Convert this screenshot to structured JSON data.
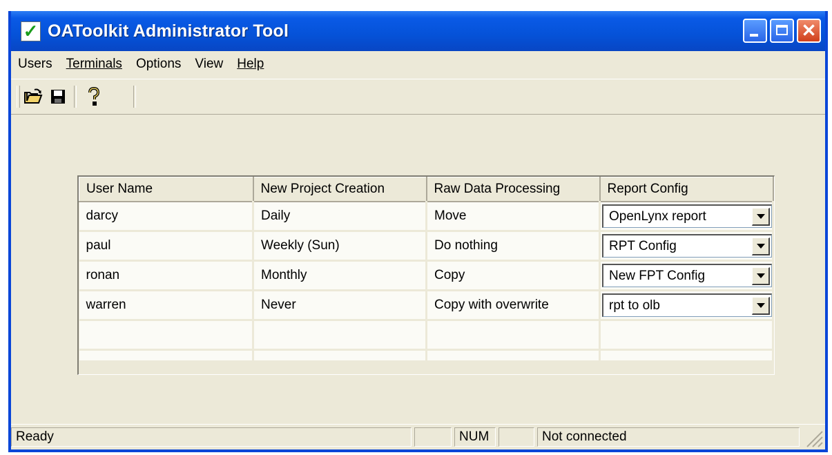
{
  "window": {
    "title": "OAToolkit Administrator Tool",
    "title_icon": "checkmark-icon",
    "checkmark_glyph": "✓",
    "close_glyph": "✕"
  },
  "menu": {
    "items": [
      "Users",
      "Terminals",
      "Options",
      "View",
      "Help"
    ]
  },
  "toolbar": {
    "buttons": [
      "open-folder-icon",
      "save-disk-icon",
      "help-question-icon"
    ]
  },
  "grid": {
    "columns": [
      "User Name",
      "New Project Creation",
      "Raw Data Processing",
      "Report Config"
    ],
    "rows": [
      {
        "user": "darcy",
        "creation": "Daily",
        "processing": "Move",
        "report": "OpenLynx report"
      },
      {
        "user": "paul",
        "creation": "Weekly (Sun)",
        "processing": "Do nothing",
        "report": "RPT Config"
      },
      {
        "user": "ronan",
        "creation": "Monthly",
        "processing": "Copy",
        "report": "New FPT Config"
      },
      {
        "user": "warren",
        "creation": "Never",
        "processing": "Copy with overwrite",
        "report": "rpt to olb"
      }
    ]
  },
  "status": {
    "message": "Ready",
    "num": "NUM",
    "connection": "Not connected"
  },
  "colors": {
    "titlebar": "#0552d8",
    "face": "#ece9d8",
    "close_button": "#d0401c"
  }
}
